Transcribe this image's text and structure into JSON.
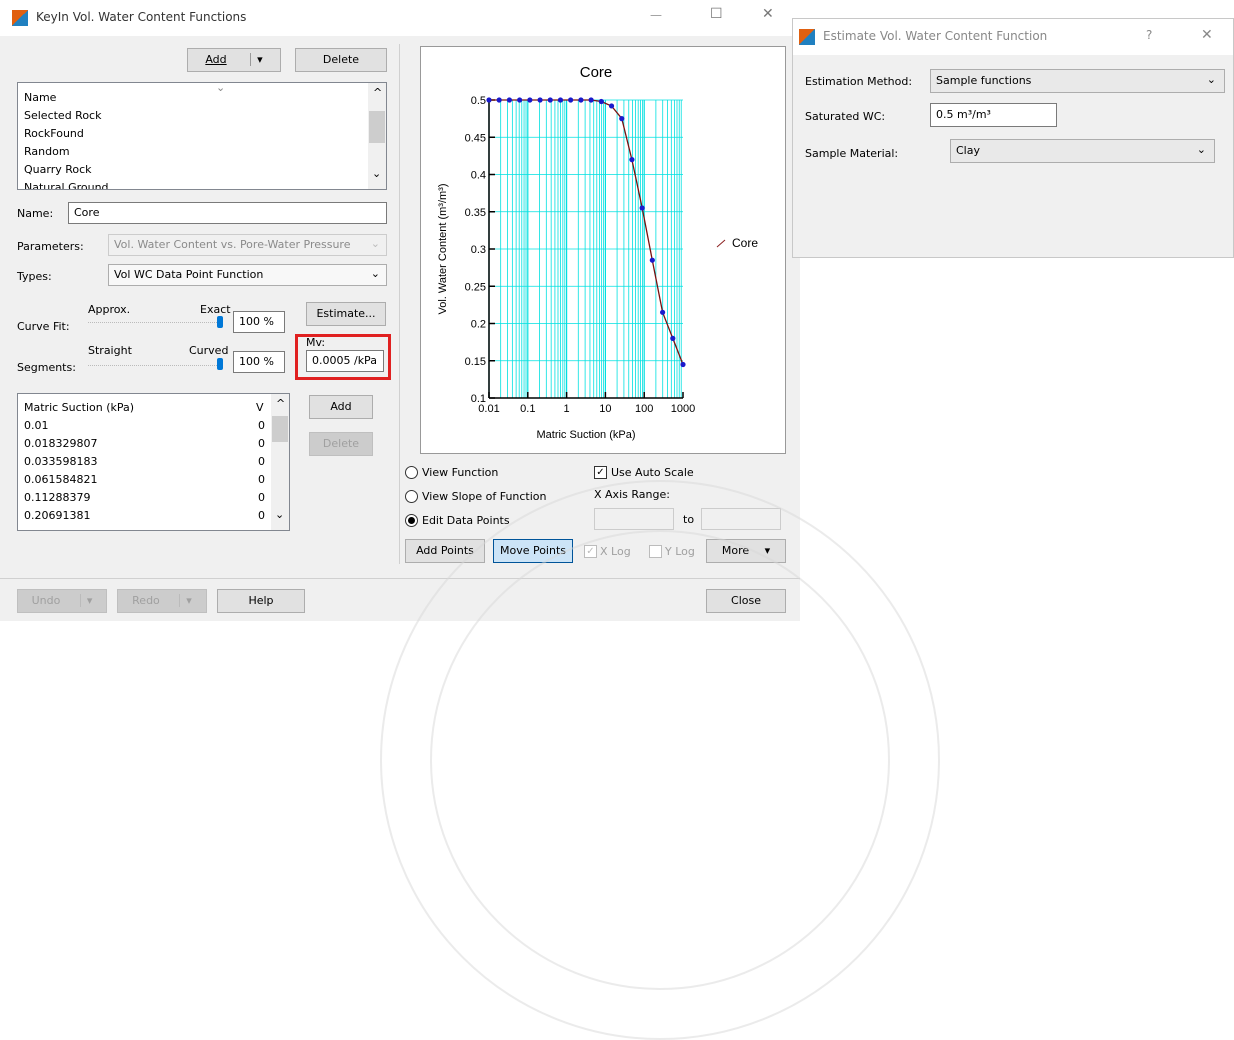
{
  "main_window": {
    "title": "KeyIn Vol. Water Content Functions",
    "controls": {
      "minimize": "—",
      "maximize": "☐",
      "close": "✕"
    }
  },
  "toolbar": {
    "add_label": "Add",
    "add_dropdown": "▾",
    "delete_label": "Delete"
  },
  "function_list": {
    "items": [
      "Name",
      "Selected Rock",
      "RockFound",
      "Random",
      "Quarry Rock",
      "Natural Ground"
    ],
    "sort_indicator": "⌄",
    "scroll_up": "^",
    "scroll_down": "⌄"
  },
  "form": {
    "name_label": "Name:",
    "name_value": "Core",
    "parameters_label": "Parameters:",
    "parameters_value": "Vol. Water Content vs. Pore-Water Pressure",
    "types_label": "Types:",
    "types_value": "Vol WC Data Point Function",
    "curve_fit_label": "Curve Fit:",
    "approx_label": "Approx.",
    "exact_label": "Exact",
    "curve_fit_value": "100 %",
    "segments_label": "Segments:",
    "straight_label": "Straight",
    "curved_label": "Curved",
    "segments_value": "100 %",
    "estimate_label": "Estimate...",
    "mv_label": "Mv:",
    "mv_value": "0.0005 /kPa"
  },
  "data_table": {
    "col1": "Matric Suction (kPa)",
    "col2": "V",
    "rows": [
      [
        "0.01",
        "0"
      ],
      [
        "0.018329807",
        "0"
      ],
      [
        "0.033598183",
        "0"
      ],
      [
        "0.061584821",
        "0"
      ],
      [
        "0.11288379",
        "0"
      ],
      [
        "0.20691381",
        "0"
      ]
    ],
    "add_label": "Add",
    "delete_label": "Delete"
  },
  "view_options": {
    "view_function": "View Function",
    "view_slope": "View Slope of Function",
    "edit_points": "Edit Data Points",
    "use_auto_scale": "Use Auto Scale",
    "x_axis_range": "X Axis Range:",
    "to_label": "to",
    "add_points": "Add Points",
    "move_points": "Move Points",
    "x_log": "X Log",
    "y_log": "Y Log",
    "more": "More"
  },
  "bottom_bar": {
    "undo": "Undo",
    "redo": "Redo",
    "help": "Help",
    "close": "Close",
    "dropdown": "▾"
  },
  "estimate_window": {
    "title": "Estimate Vol. Water Content Function",
    "help": "?",
    "close": "✕",
    "method_label": "Estimation Method:",
    "method_value": "Sample functions",
    "sat_wc_label": "Saturated WC:",
    "sat_wc_value": "0.5 m³/m³",
    "material_label": "Sample Material:",
    "material_value": "Clay",
    "chevron": "⌄"
  },
  "chart_data": {
    "type": "line",
    "title": "Core",
    "xlabel": "Matric Suction (kPa)",
    "ylabel": "Vol. Water Content (m³/m³)",
    "x_scale": "log",
    "xlim": [
      0.01,
      1000
    ],
    "ylim": [
      0.1,
      0.5
    ],
    "x_ticks": [
      "0.01",
      "0.1",
      "1",
      "10",
      "100",
      "1000"
    ],
    "y_ticks": [
      "0.1",
      "0.15",
      "0.2",
      "0.25",
      "0.3",
      "0.35",
      "0.4",
      "0.45",
      "0.5"
    ],
    "grid": true,
    "legend": "right",
    "series": [
      {
        "name": "Core",
        "color": "#8b2020",
        "x": [
          0.01,
          0.0183,
          0.0336,
          0.0616,
          0.113,
          0.207,
          0.379,
          0.695,
          1.27,
          2.34,
          4.28,
          7.85,
          14.4,
          26.4,
          48.3,
          88.6,
          162,
          298,
          546,
          1000
        ],
        "y": [
          0.5,
          0.5,
          0.5,
          0.5,
          0.5,
          0.5,
          0.5,
          0.5,
          0.5,
          0.5,
          0.5,
          0.498,
          0.492,
          0.475,
          0.42,
          0.355,
          0.285,
          0.215,
          0.18,
          0.145
        ]
      }
    ],
    "colors": {
      "grid": "#00e0e0",
      "points": "#1a1acc",
      "line": "#7a1010"
    }
  }
}
